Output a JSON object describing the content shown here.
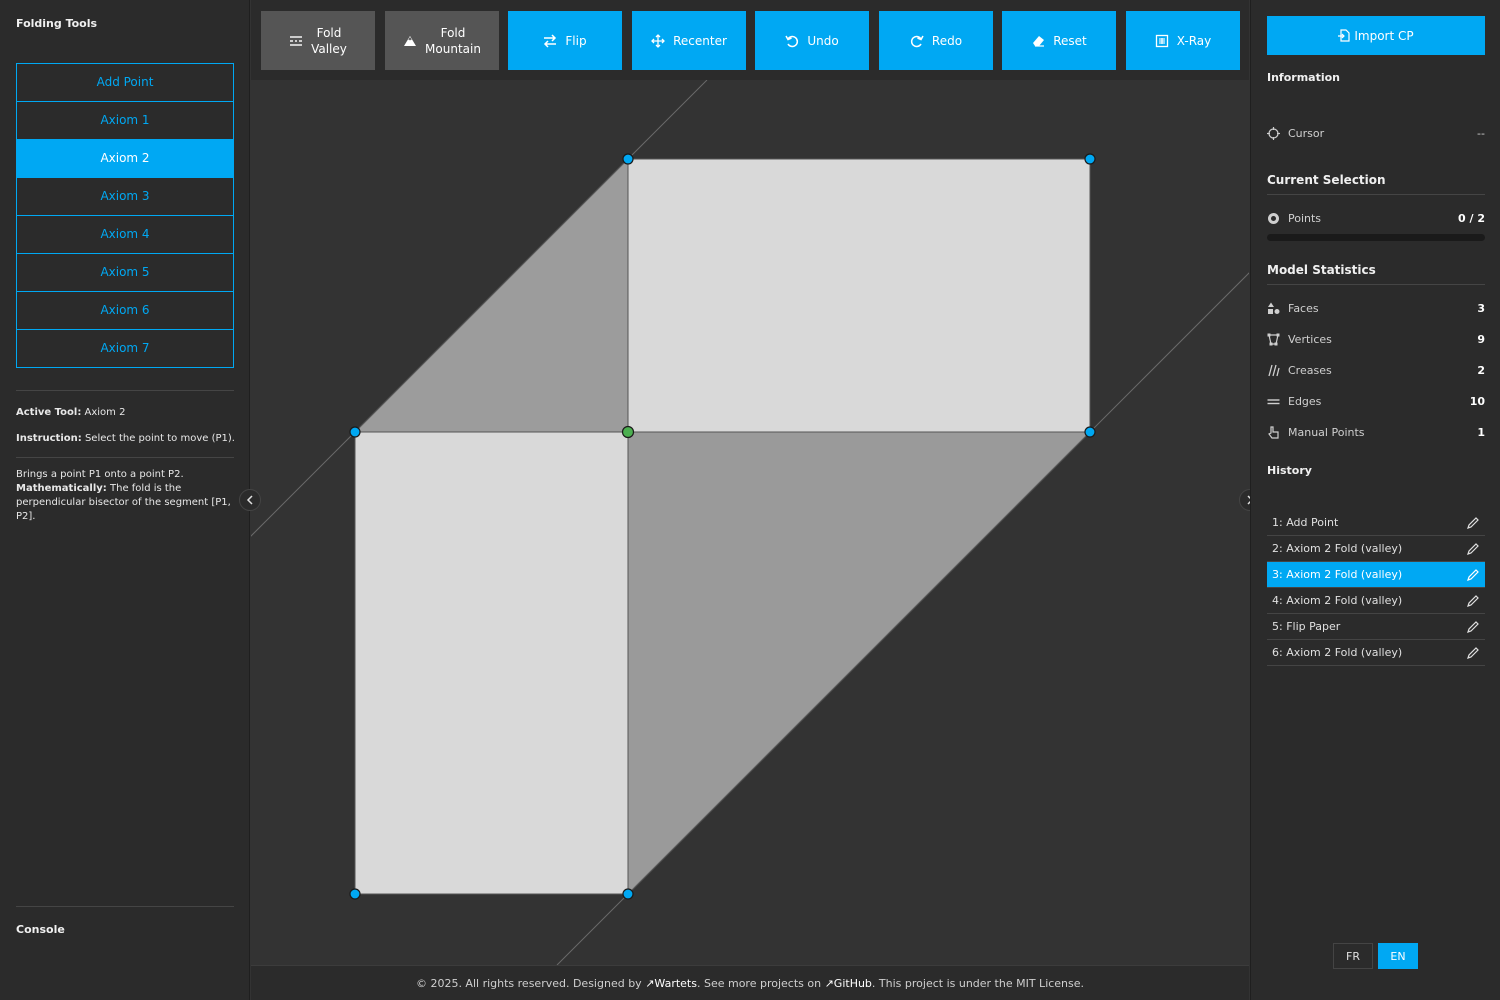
{
  "left_panel": {
    "title": "Folding Tools",
    "tools": [
      {
        "label": "Add Point",
        "active": false
      },
      {
        "label": "Axiom 1",
        "active": false
      },
      {
        "label": "Axiom 2",
        "active": true
      },
      {
        "label": "Axiom 3",
        "active": false
      },
      {
        "label": "Axiom 4",
        "active": false
      },
      {
        "label": "Axiom 5",
        "active": false
      },
      {
        "label": "Axiom 6",
        "active": false
      },
      {
        "label": "Axiom 7",
        "active": false
      }
    ],
    "active_tool_label": "Active Tool:",
    "active_tool_value": "Axiom 2",
    "instruction_label": "Instruction:",
    "instruction_value": "Select the point to move (P1).",
    "description_line1": "Brings a point P1 onto a point P2.",
    "description_math_label": "Mathematically:",
    "description_math_text": "The fold is the perpendicular bisector of the segment [P1, P2].",
    "console_title": "Console"
  },
  "toolbar": {
    "fold_valley": "Fold\nValley",
    "fold_mountain": "Fold\nMountain",
    "flip": "Flip",
    "recenter": "Recenter",
    "undo": "Undo",
    "redo": "Redo",
    "reset": "Reset",
    "xray": "X-Ray"
  },
  "right_panel": {
    "import_label": "Import CP",
    "information_title": "Information",
    "cursor_label": "Cursor",
    "cursor_value": "--",
    "current_selection_title": "Current Selection",
    "points_label": "Points",
    "points_value": "0 / 2",
    "points_progress": 0,
    "model_stats_title": "Model Statistics",
    "stats": [
      {
        "label": "Faces",
        "value": "3",
        "icon": "shapes-icon"
      },
      {
        "label": "Vertices",
        "value": "9",
        "icon": "vertices-icon"
      },
      {
        "label": "Creases",
        "value": "2",
        "icon": "creases-icon"
      },
      {
        "label": "Edges",
        "value": "10",
        "icon": "edges-icon"
      },
      {
        "label": "Manual Points",
        "value": "1",
        "icon": "pointer-icon"
      }
    ],
    "history_title": "History",
    "history": [
      {
        "label": "1: Add Point",
        "active": false
      },
      {
        "label": "2: Axiom 2 Fold (valley)",
        "active": false
      },
      {
        "label": "3: Axiom 2 Fold (valley)",
        "active": true
      },
      {
        "label": "4: Axiom 2 Fold (valley)",
        "active": false
      },
      {
        "label": "5: Flip Paper",
        "active": false
      },
      {
        "label": "6: Axiom 2 Fold (valley)",
        "active": false
      }
    ],
    "lang_fr": "FR",
    "lang_en": "EN",
    "active_lang": "EN"
  },
  "footer": {
    "part1": "© 2025. All rights reserved. Designed by ",
    "author": "Wartets",
    "part2": ". See more projects on ",
    "github": "GitHub",
    "part3": ". This project is under the MIT License."
  },
  "colors": {
    "accent": "#00a8f3",
    "panel": "#2b2b2b",
    "canvas": "#333333",
    "paper_light": "#d9d9d9",
    "paper_dark": "#999999",
    "vertex": "#00a8f3",
    "manual_vertex": "#4caf50"
  }
}
